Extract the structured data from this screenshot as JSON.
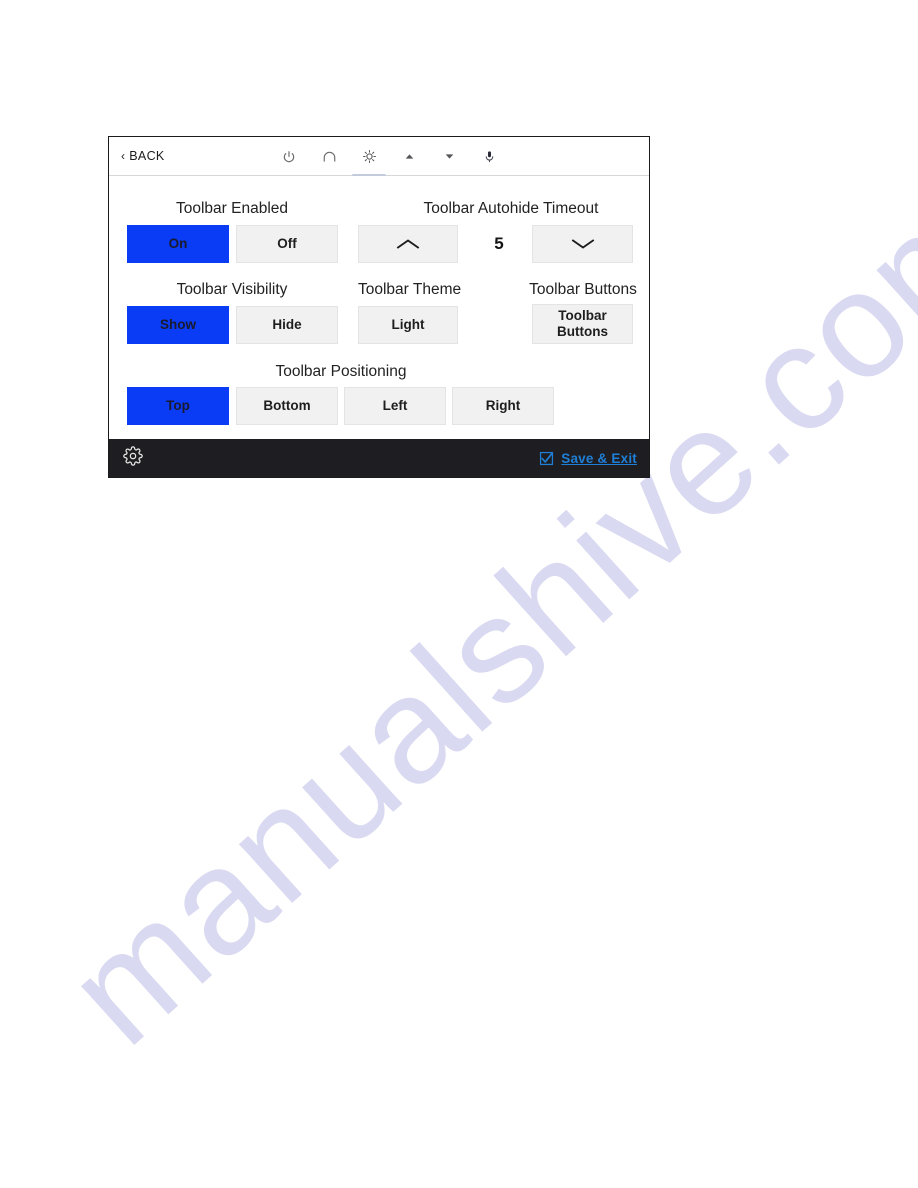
{
  "watermark": {
    "text": "manualshive.com"
  },
  "device": {
    "nav": {
      "back_label": "BACK",
      "back_chevron": "‹",
      "icons": [
        {
          "name": "power-icon",
          "label": "Power",
          "active": false
        },
        {
          "name": "home-icon",
          "label": "Home",
          "active": false
        },
        {
          "name": "brightness-icon",
          "label": "Brightness",
          "active": true
        },
        {
          "name": "triangle-up-icon",
          "label": "Volume Up",
          "active": false
        },
        {
          "name": "triangle-down-icon",
          "label": "Volume Down",
          "active": false
        },
        {
          "name": "microphone-icon",
          "label": "Microphone",
          "active": false
        }
      ]
    },
    "settings": {
      "toolbar_enabled": {
        "label": "Toolbar Enabled",
        "options": [
          "On",
          "Off"
        ],
        "selected": "On"
      },
      "toolbar_autohide_timeout": {
        "label": "Toolbar Autohide Timeout",
        "increase_icon": "chevron-up-icon",
        "decrease_icon": "chevron-down-icon",
        "value": "5"
      },
      "toolbar_visibility": {
        "label": "Toolbar Visibility",
        "options": [
          "Show",
          "Hide"
        ],
        "selected": "Show"
      },
      "toolbar_theme": {
        "label": "Toolbar Theme",
        "options": [
          "Light"
        ],
        "selected": "Light"
      },
      "toolbar_buttons": {
        "label": "Toolbar Buttons",
        "button_line1": "Toolbar",
        "button_line2": "Buttons"
      },
      "toolbar_positioning": {
        "label": "Toolbar Positioning",
        "options": [
          "Top",
          "Bottom",
          "Left",
          "Right"
        ],
        "selected": "Top"
      }
    },
    "bottom_bar": {
      "gear_icon": "gear-icon",
      "save_exit_label": "Save & Exit",
      "save_exit_checkbox": "checked-checkbox-icon"
    }
  },
  "colors": {
    "accent_blue": "#0a3bf5",
    "link_blue": "#1f7fd6",
    "button_bg": "#f1f1f1",
    "bottom_bar_bg": "#1e1e22",
    "watermark": "#cfcfee"
  }
}
